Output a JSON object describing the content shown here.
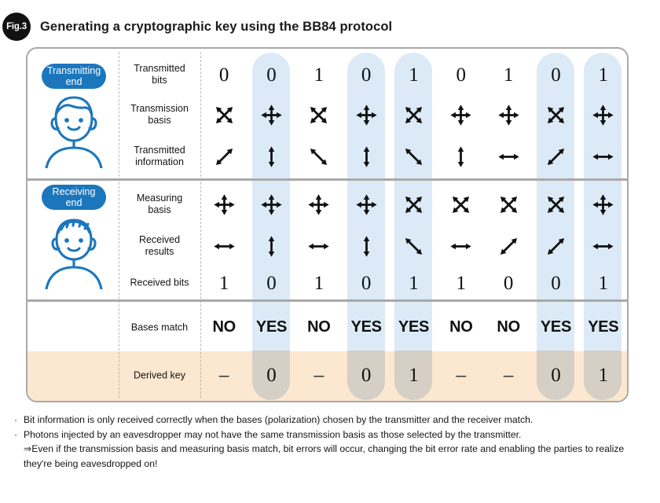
{
  "header": {
    "badge": "Fig.3",
    "title": "Generating a cryptographic key using the BB84 protocol"
  },
  "table": {
    "parties": [
      {
        "pill_line1": "Transmitting",
        "pill_line2": "end",
        "avatar": "female-avatar-icon"
      },
      {
        "pill_line1": "Receiving",
        "pill_line2": "end",
        "avatar": "male-avatar-icon"
      }
    ],
    "row_labels": {
      "transmitted_bits": "Transmitted\nbits",
      "transmitted_bits_l1": "Transmitted",
      "transmitted_bits_l2": "bits",
      "transmission_basis_l1": "Transmission",
      "transmission_basis_l2": "basis",
      "transmitted_information_l1": "Transmitted",
      "transmitted_information_l2": "information",
      "measuring_basis_l1": "Measuring",
      "measuring_basis_l2": "basis",
      "received_results_l1": "Received",
      "received_results_l2": "results",
      "received_bits": "Received bits",
      "bases_match": "Bases match",
      "derived_key": "Derived key"
    },
    "columns": 9,
    "highlighted_columns": [
      2,
      4,
      5,
      8,
      9
    ],
    "transmitted_bits": [
      "0",
      "0",
      "1",
      "0",
      "1",
      "0",
      "1",
      "0",
      "1"
    ],
    "transmission_basis": [
      "x",
      "plus",
      "x",
      "plus",
      "x",
      "plus",
      "plus",
      "x",
      "plus"
    ],
    "transmitted_information": [
      "diag-up",
      "vertical",
      "diag-down",
      "vertical",
      "diag-down",
      "vertical",
      "horizontal",
      "diag-up",
      "horizontal"
    ],
    "measuring_basis": [
      "plus",
      "plus",
      "plus",
      "plus",
      "x",
      "x",
      "x",
      "x",
      "plus"
    ],
    "received_results": [
      "horizontal",
      "vertical",
      "horizontal",
      "vertical",
      "diag-down",
      "horizontal",
      "diag-up",
      "diag-up",
      "horizontal"
    ],
    "received_bits": [
      "1",
      "0",
      "1",
      "0",
      "1",
      "1",
      "0",
      "0",
      "1"
    ],
    "bases_match": [
      "NO",
      "YES",
      "NO",
      "YES",
      "YES",
      "NO",
      "NO",
      "YES",
      "YES"
    ],
    "derived_key": [
      "–",
      "0",
      "–",
      "0",
      "1",
      "–",
      "–",
      "0",
      "1"
    ]
  },
  "notes": [
    {
      "bullet": "·",
      "text": "Bit information is only received correctly when the bases (polarization) chosen by the transmitter and the receiver match."
    },
    {
      "bullet": "·",
      "text": "Photons injected by an eavesdropper may not have the same transmission basis as those selected by the transmitter."
    }
  ],
  "subnote": "⇒Even if the transmission basis and measuring basis match, bit errors will occur, changing the bit error rate and enabling the parties to realize they're being eavesdropped on!",
  "colors": {
    "accent_blue": "#1c76bc",
    "highlight_blue": "#dbeaf6",
    "peach": "#fce7d0",
    "border_gray": "#a9a9a9",
    "badge_black": "#111111"
  }
}
